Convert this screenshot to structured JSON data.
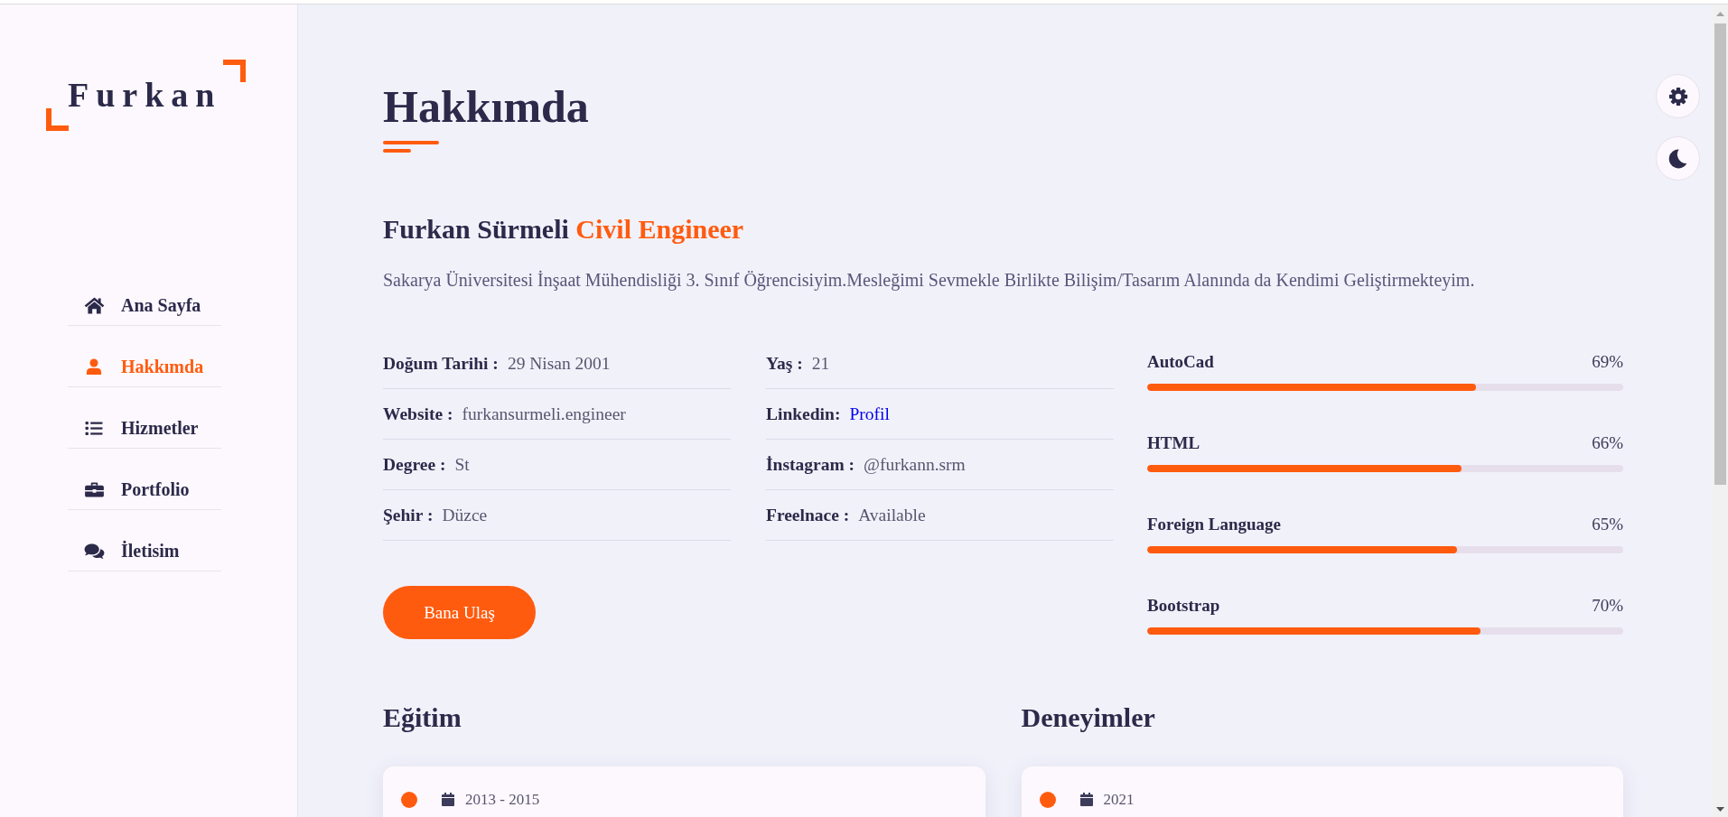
{
  "sidebar": {
    "logo": "Furkan",
    "nav": [
      {
        "label": "Ana Sayfa",
        "selected": false
      },
      {
        "label": "Hakkımda",
        "selected": true
      },
      {
        "label": "Hizmetler",
        "selected": false
      },
      {
        "label": "Portfolio",
        "selected": false
      },
      {
        "label": "İletisim",
        "selected": false
      }
    ]
  },
  "about": {
    "title": "Hakkımda",
    "name": "Furkan Sürmeli",
    "role": "Civil Engineer",
    "intro": "Sakarya Üniversitesi İnşaat Mühendisliği 3. Sınıf Öğrencisiyim.Mesleğimi Sevmekle Birlikte Bilişim/Tasarım Alanında da Kendimi Geliştirmekteyim.",
    "info_columns": [
      [
        {
          "label": "Doğum Tarihi :",
          "value": "29 Nisan 2001",
          "kind": "text"
        },
        {
          "label": "Website :",
          "value": "furkansurmeli.engineer",
          "kind": "text"
        },
        {
          "label": "Degree :",
          "value": "St",
          "kind": "text"
        },
        {
          "label": "Şehir :",
          "value": "Düzce",
          "kind": "text"
        }
      ],
      [
        {
          "label": "Yaş :",
          "value": "21",
          "kind": "text"
        },
        {
          "label": "Linkedin:",
          "value": "Profil",
          "kind": "link"
        },
        {
          "label": "İnstagram :",
          "value": "@furkann.srm",
          "kind": "text"
        },
        {
          "label": "Freelnace :",
          "value": "Available",
          "kind": "text"
        }
      ]
    ],
    "button": "Bana Ulaş",
    "skills": [
      {
        "name": "AutoCad",
        "reading": "69%",
        "level": 0.69
      },
      {
        "name": "HTML",
        "reading": "66%",
        "level": 0.66
      },
      {
        "name": "Foreign Language",
        "reading": "65%",
        "level": 0.65
      },
      {
        "name": "Bootstrap",
        "reading": "70%",
        "level": 0.7
      }
    ]
  },
  "education": {
    "title": "Eğitim",
    "items": [
      {
        "date": "2013 - 2015"
      }
    ]
  },
  "experience": {
    "title": "Deneyimler",
    "items": [
      {
        "date": "2021"
      }
    ]
  }
}
